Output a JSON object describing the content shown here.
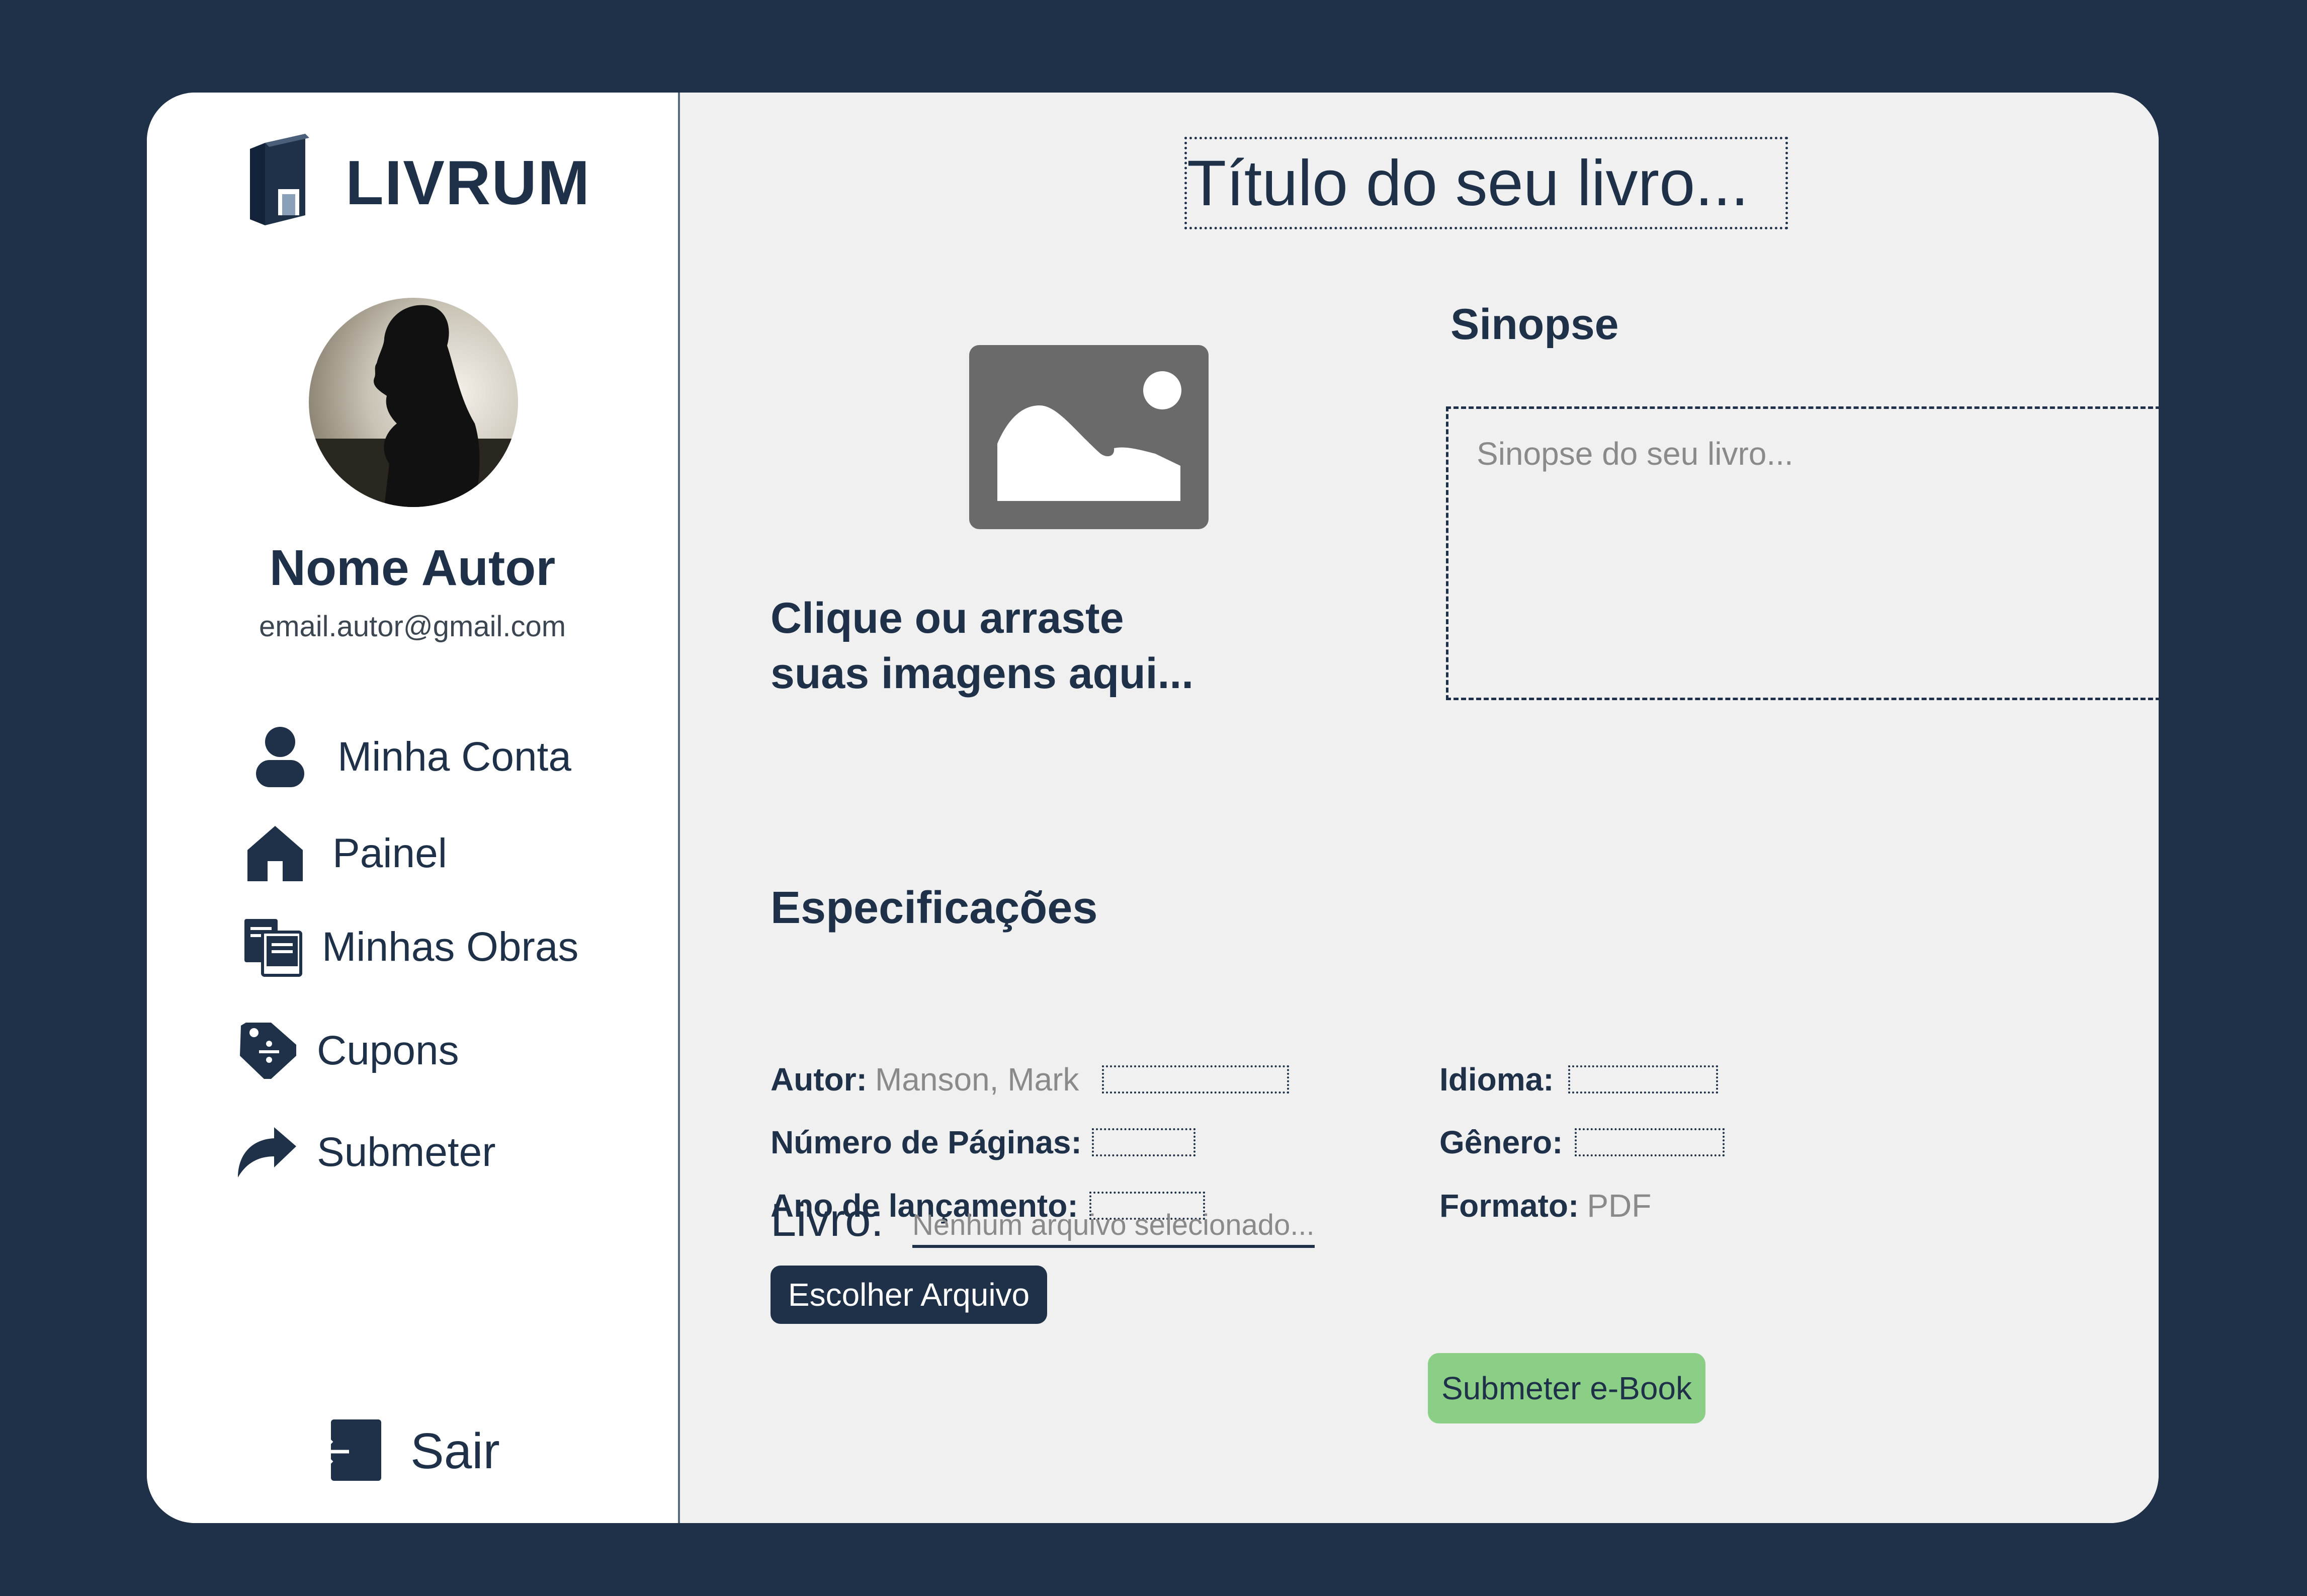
{
  "app": {
    "logo_text": "LIVRUM"
  },
  "profile": {
    "name": "Nome Autor",
    "email": "email.autor@gmail.com"
  },
  "sidebar": {
    "items": [
      {
        "label": "Minha Conta",
        "icon": "user-icon"
      },
      {
        "label": "Painel",
        "icon": "home-icon"
      },
      {
        "label": "Minhas Obras",
        "icon": "books-icon"
      },
      {
        "label": "Cupons",
        "icon": "coupon-tag-icon"
      },
      {
        "label": "Submeter",
        "icon": "share-arrow-icon"
      }
    ],
    "logout": {
      "label": "Sair",
      "icon": "logout-icon"
    }
  },
  "editor": {
    "title_placeholder": "Título do seu livro...",
    "image_drop_text_line1": "Clique ou arraste",
    "image_drop_text_line2": "suas imagens aqui...",
    "synopsis_label": "Sinopse",
    "synopsis_placeholder": "Sinopse do seu livro..."
  },
  "specs": {
    "title": "Especificações",
    "autor_label": "Autor:",
    "autor_value": "Manson, Mark",
    "paginas_label": "Número de Páginas:",
    "ano_label": "Ano de lançamento:",
    "idioma_label": "Idioma:",
    "genero_label": "Gênero:",
    "formato_label": "Formato:",
    "formato_value": "PDF"
  },
  "upload": {
    "livro_label": "Livro:",
    "file_status": "Nenhum arquivo selecionado...",
    "choose_button": "Escolher Arquivo"
  },
  "submit": {
    "label": "Submeter e-Book"
  },
  "colors": {
    "navy": "#1e3148",
    "panel": "#f0f0f0",
    "submit_green": "#8acf85",
    "placeholder_gray": "#8a8a8a"
  }
}
